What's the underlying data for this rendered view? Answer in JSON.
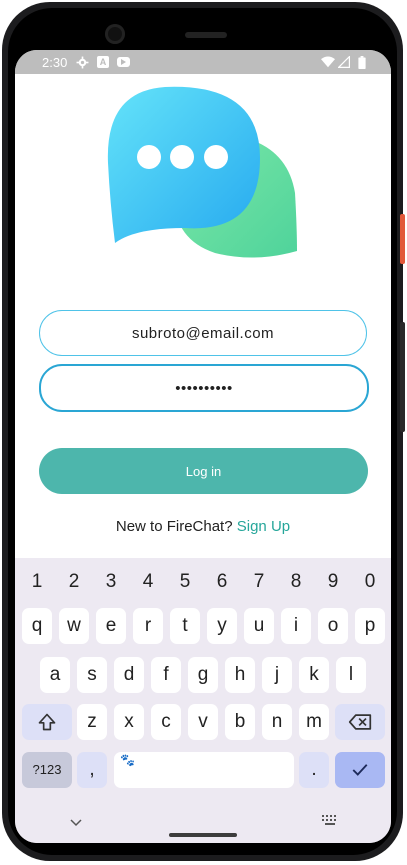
{
  "status_bar": {
    "time": "2:30",
    "icons": [
      "gear-icon",
      "a-icon",
      "youtube-icon",
      "wifi-icon",
      "signal-icon",
      "battery-icon"
    ]
  },
  "login": {
    "email_value": "subroto@email.com",
    "password_value": "••••••••••",
    "login_label": "Log in",
    "signup_prompt": "New to FireChat?",
    "signup_link": "Sign Up"
  },
  "keyboard": {
    "digits": [
      "1",
      "2",
      "3",
      "4",
      "5",
      "6",
      "7",
      "8",
      "9",
      "0"
    ],
    "row1": [
      "q",
      "w",
      "e",
      "r",
      "t",
      "y",
      "u",
      "i",
      "o",
      "p"
    ],
    "row2": [
      "a",
      "s",
      "d",
      "f",
      "g",
      "h",
      "j",
      "k",
      "l"
    ],
    "row3": [
      "z",
      "x",
      "c",
      "v",
      "b",
      "n",
      "m"
    ],
    "symbols_label": "?123",
    "comma": ",",
    "period": ".",
    "status_key_label": "A"
  },
  "colors": {
    "accent_teal": "#4db6ac",
    "field_border": "#4fc3e8",
    "signup_link": "#26a69a",
    "bubble_blue": "#3cc3f3",
    "bubble_green": "#5fd9a0"
  }
}
